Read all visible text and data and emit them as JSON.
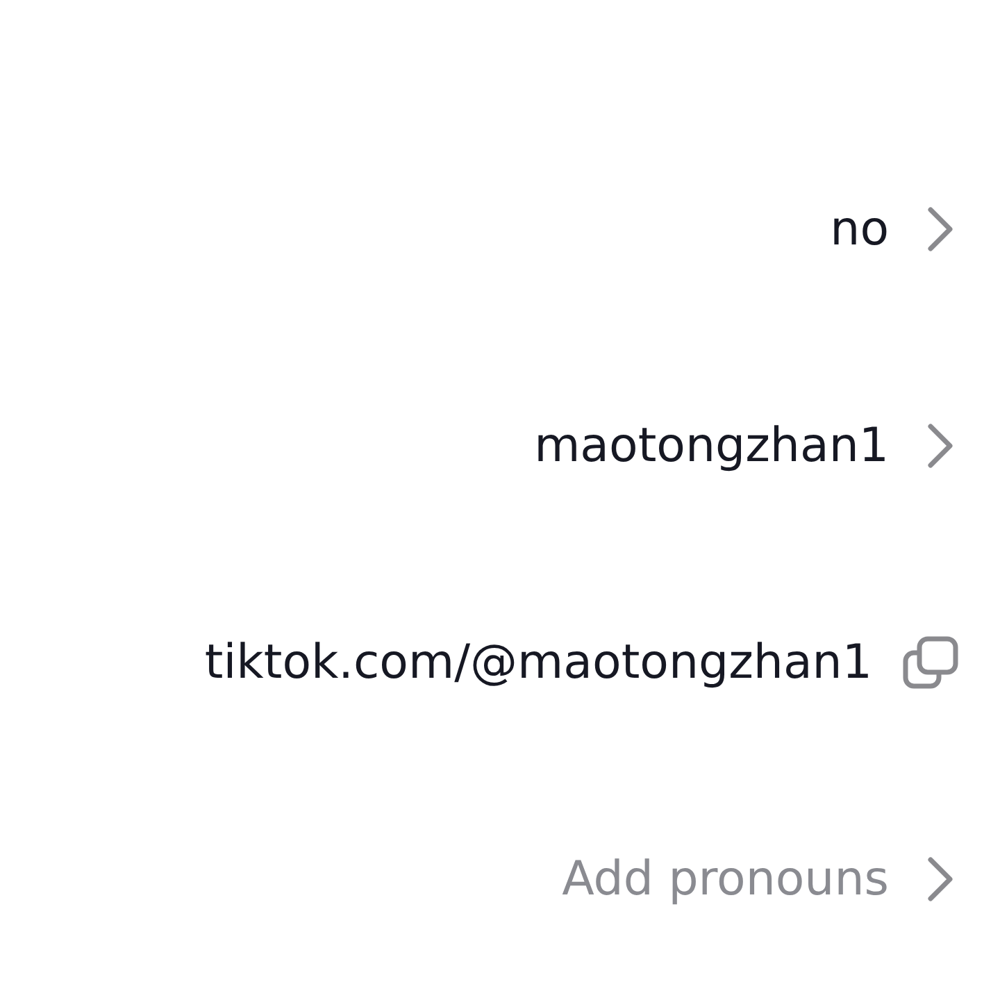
{
  "rows": [
    {
      "kind": "chevron",
      "value": "no"
    },
    {
      "kind": "chevron",
      "value": "maotongzhan1"
    },
    {
      "kind": "copy",
      "value": "tiktok.com/@maotongzhan1"
    },
    {
      "kind": "chevron",
      "placeholder": "Add pronouns"
    }
  ]
}
